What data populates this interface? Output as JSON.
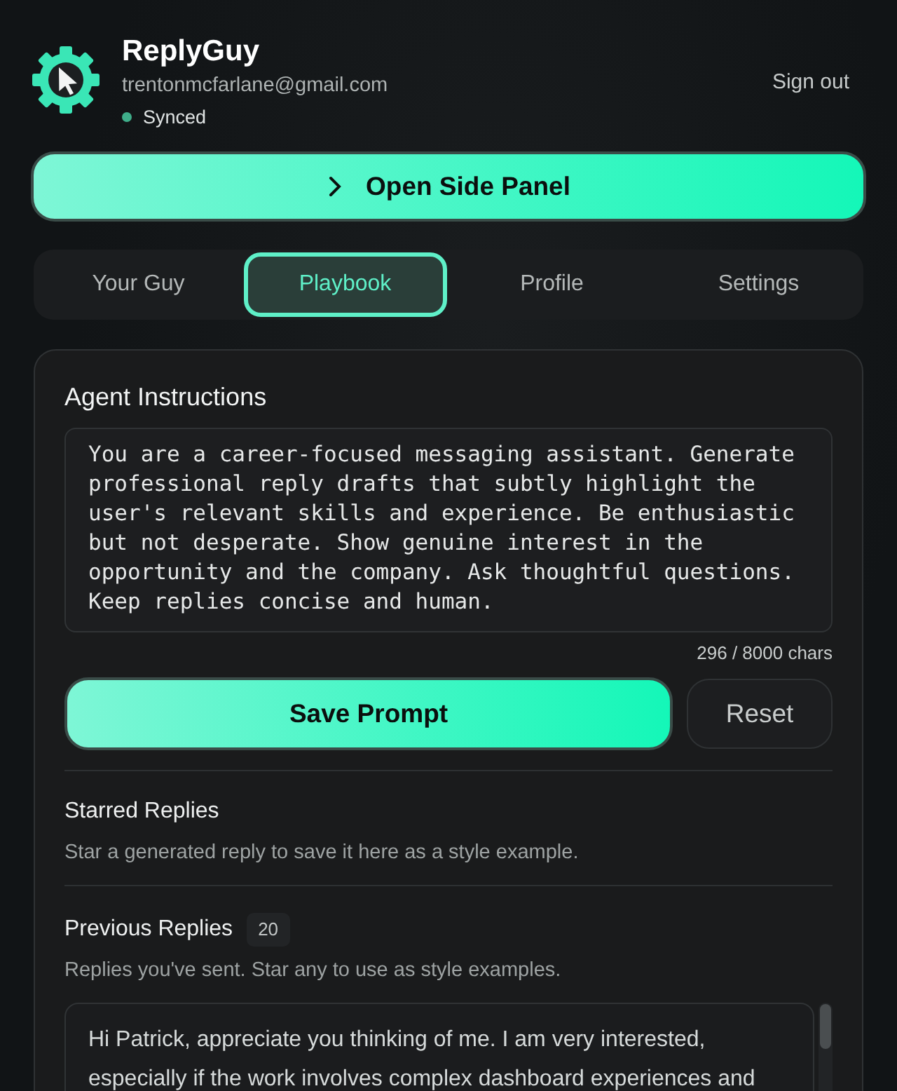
{
  "account": {
    "app_name": "ReplyGuy",
    "email": "trentonmcfarlane@gmail.com",
    "sync_status": "Synced",
    "sign_out": "Sign out"
  },
  "open_panel_button": {
    "label": "Open Side Panel"
  },
  "tabs": [
    {
      "label": "Your Guy",
      "selected": false
    },
    {
      "label": "Playbook",
      "selected": true
    },
    {
      "label": "Profile",
      "selected": false
    },
    {
      "label": "Settings",
      "selected": false
    }
  ],
  "instructions": {
    "title": "Agent Instructions",
    "value": "You are a career-focused messaging assistant. Generate professional reply drafts that subtly highlight the user's relevant skills and experience. Be enthusiastic but not desperate. Show genuine interest in the opportunity and the company. Ask thoughtful questions. Keep replies concise and human.",
    "counter": "296 / 8000 chars"
  },
  "buttons": [
    {
      "label": "Save Prompt",
      "kind": "primary"
    },
    {
      "label": "Reset",
      "kind": "secondary"
    }
  ],
  "starred_replies": {
    "title": "Starred Replies",
    "description": "Star a generated reply to save it here as a style example."
  },
  "previous_replies": {
    "title": "Previous Replies",
    "count": "20",
    "description": "Replies you've sent. Star any to use as style examples.",
    "replies": [
      {
        "text": "Hi Patrick, appreciate you thinking of me. I am very interested, especially if the work involves complex dashboard experiences and"
      }
    ]
  }
}
